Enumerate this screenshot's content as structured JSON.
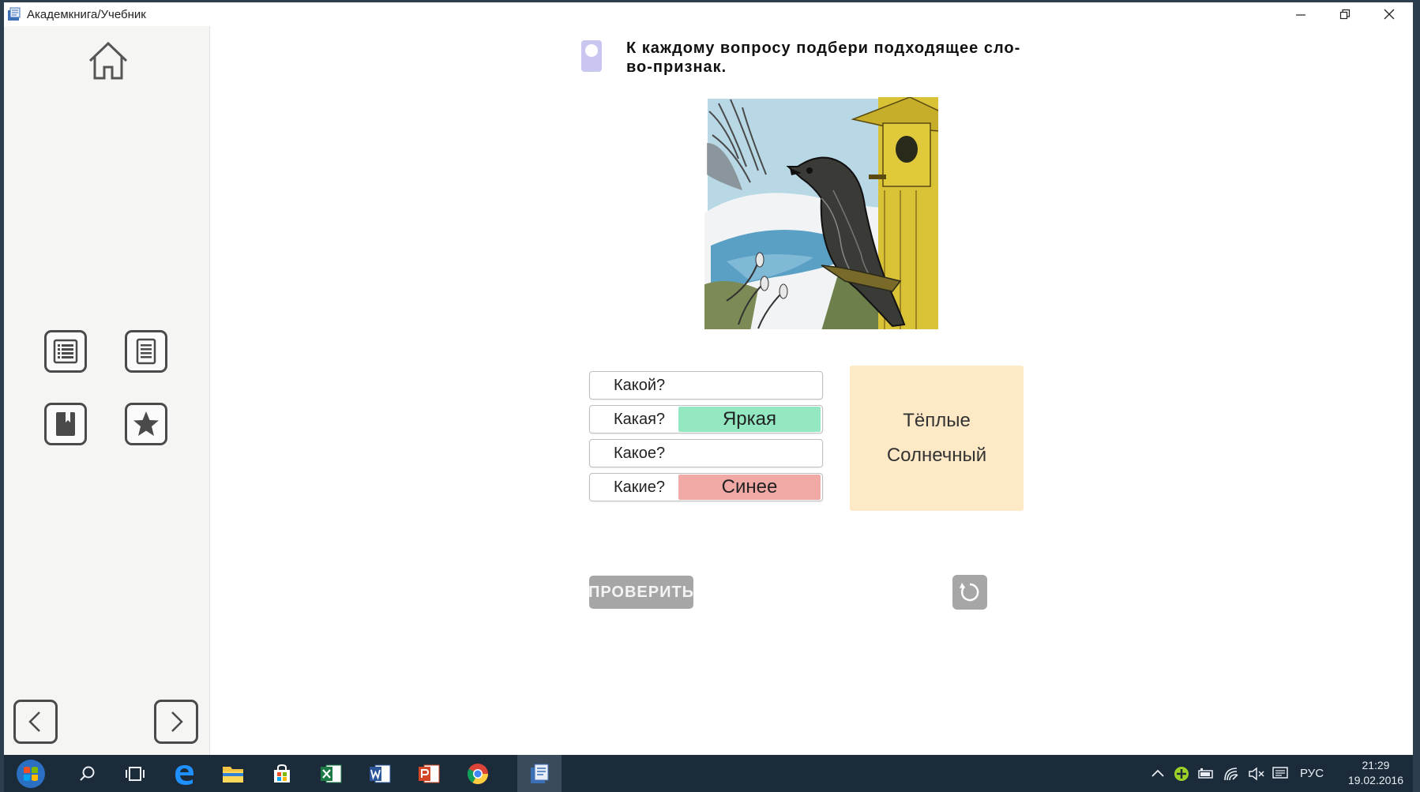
{
  "window": {
    "title": "Академкнига/Учебник"
  },
  "sidebar": {
    "home": "home-icon",
    "tools": [
      "contents-list-icon",
      "page-text-icon",
      "bookmark-book-icon",
      "star-favorites-icon"
    ],
    "nav": [
      "chevron-left-icon",
      "chevron-right-icon"
    ]
  },
  "task": {
    "instruction": "К каждому вопросу подбери подходящее сло-во-признак.",
    "instruction_line1": "К каждому вопросу подбери подходящее сло-",
    "instruction_line2": "во-признак."
  },
  "questions": [
    {
      "label": "Какой?",
      "answer": ""
    },
    {
      "label": "Какая?",
      "answer": "Яркая",
      "state": "correct"
    },
    {
      "label": "Какое?",
      "answer": ""
    },
    {
      "label": "Какие?",
      "answer": "Синее",
      "state": "wrong"
    }
  ],
  "word_bank": [
    "Тёплые",
    "Солнечный"
  ],
  "buttons": {
    "check": "ПРОВЕРИТЬ",
    "reset_icon": "reset-arrow-icon"
  },
  "taskbar": {
    "lang": "РУС",
    "time": "21:29",
    "date": "19.02.2016"
  },
  "colors": {
    "correct": "#93e8c2",
    "wrong": "#f1a9a6",
    "word_bank_bg": "#fde9c6",
    "button_disabled": "#a6a6a6",
    "task_marker": "#c9c6f0"
  }
}
